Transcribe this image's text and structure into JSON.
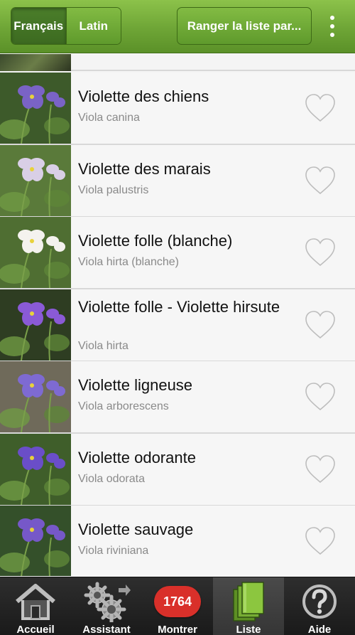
{
  "toolbar": {
    "lang_french": "Français",
    "lang_latin": "Latin",
    "sort_label": "Ranger la liste par...",
    "overflow_icon": "more-vert-icon"
  },
  "list": {
    "items": [
      {
        "common": "Violette des chiens",
        "latin": "Viola canina",
        "favorite": false,
        "photo_colors": [
          "#7a63c6",
          "#3d5a2a"
        ]
      },
      {
        "common": "Violette des marais",
        "latin": "Viola palustris",
        "favorite": false,
        "photo_colors": [
          "#d9cfe6",
          "#5a7a3a"
        ]
      },
      {
        "common": "Violette folle (blanche)",
        "latin": "Viola hirta (blanche)",
        "favorite": false,
        "photo_colors": [
          "#f4f2ee",
          "#4f6e32"
        ]
      },
      {
        "common": "Violette folle - Violette hirsute",
        "latin": "Viola hirta",
        "favorite": false,
        "photo_colors": [
          "#8a5ad6",
          "#2e3d22"
        ]
      },
      {
        "common": "Violette ligneuse",
        "latin": "Viola arborescens",
        "favorite": false,
        "photo_colors": [
          "#7e6ad2",
          "#6f6a5a"
        ]
      },
      {
        "common": "Violette odorante",
        "latin": "Viola odorata",
        "favorite": false,
        "photo_colors": [
          "#6a4ec8",
          "#3f5e2a"
        ]
      },
      {
        "common": "Violette sauvage",
        "latin": "Viola riviniana",
        "favorite": false,
        "photo_colors": [
          "#7658c8",
          "#34502a"
        ]
      }
    ]
  },
  "nav": {
    "home": "Accueil",
    "assistant": "Assistant",
    "show": "Montrer",
    "show_count": "1764",
    "list": "Liste",
    "help": "Aide",
    "active": "Liste"
  },
  "colors": {
    "toolbar_green": "#6ea536",
    "badge_red": "#d9302a",
    "book_green": "#8cc63f"
  }
}
